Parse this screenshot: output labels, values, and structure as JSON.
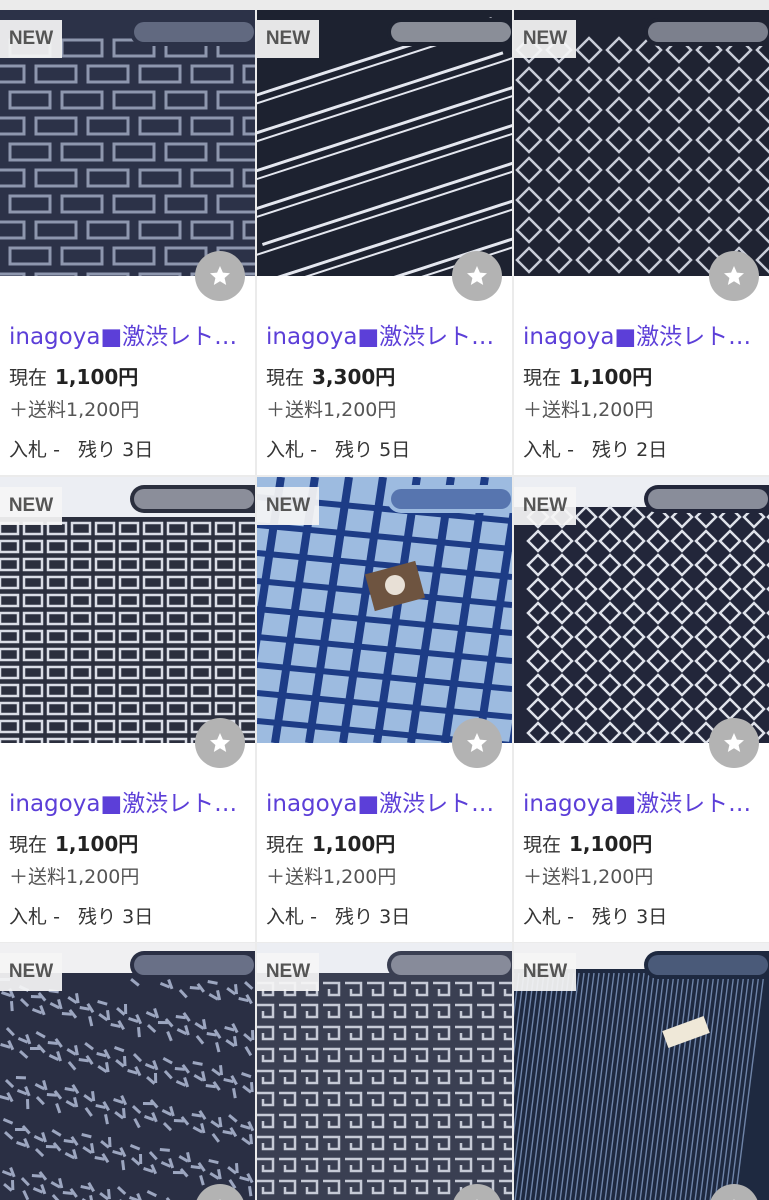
{
  "badge_text": "NEW",
  "title_color": "#5c3fd8",
  "star_button_color": "#b3b3b3",
  "listings": [
    {
      "title": "inagoya■激渋レト…",
      "price_label": "現在",
      "price": "1,100円",
      "shipping": "＋送料1,200円",
      "bid_label": "入札",
      "bids": "-",
      "remain_label": "残り",
      "remaining": "3日",
      "pattern": "maze",
      "colors": [
        "#2c3248",
        "#8e97ae"
      ]
    },
    {
      "title": "inagoya■激渋レト…",
      "price_label": "現在",
      "price": "3,300円",
      "shipping": "＋送料1,200円",
      "bid_label": "入札",
      "bids": "-",
      "remain_label": "残り",
      "remaining": "5日",
      "pattern": "zigzag-stripes",
      "colors": [
        "#1d2230",
        "#e4e7ef"
      ]
    },
    {
      "title": "inagoya■激渋レト…",
      "price_label": "現在",
      "price": "1,100円",
      "shipping": "＋送料1,200円",
      "bid_label": "入札",
      "bids": "-",
      "remain_label": "残り",
      "remaining": "2日",
      "pattern": "chain-diamond",
      "colors": [
        "#1f2332",
        "#c9cdd8"
      ]
    },
    {
      "title": "inagoya■激渋レト…",
      "price_label": "現在",
      "price": "1,100円",
      "shipping": "＋送料1,200円",
      "bid_label": "入札",
      "bids": "-",
      "remain_label": "残り",
      "remaining": "3日",
      "pattern": "rect-grid",
      "colors": [
        "#2b2f3e",
        "#dadde6"
      ]
    },
    {
      "title": "inagoya■激渋レト…",
      "price_label": "現在",
      "price": "1,100円",
      "shipping": "＋送料1,200円",
      "bid_label": "入札",
      "bids": "-",
      "remain_label": "残り",
      "remaining": "3日",
      "pattern": "blue-plaid",
      "colors": [
        "#9dbbe0",
        "#1d3c86"
      ]
    },
    {
      "title": "inagoya■激渋レト…",
      "price_label": "現在",
      "price": "1,100円",
      "shipping": "＋送料1,200円",
      "bid_label": "入札",
      "bids": "-",
      "remain_label": "残り",
      "remaining": "3日",
      "pattern": "diamond-lattice",
      "colors": [
        "#22263a",
        "#dfe2ea"
      ]
    },
    {
      "pattern": "speckle",
      "colors": [
        "#2a2f44",
        "#9ca6c0"
      ]
    },
    {
      "pattern": "key-fret",
      "colors": [
        "#3a3f52",
        "#c6cad6"
      ]
    },
    {
      "pattern": "pinstripe",
      "colors": [
        "#1e2940",
        "#6f84a8"
      ]
    }
  ]
}
